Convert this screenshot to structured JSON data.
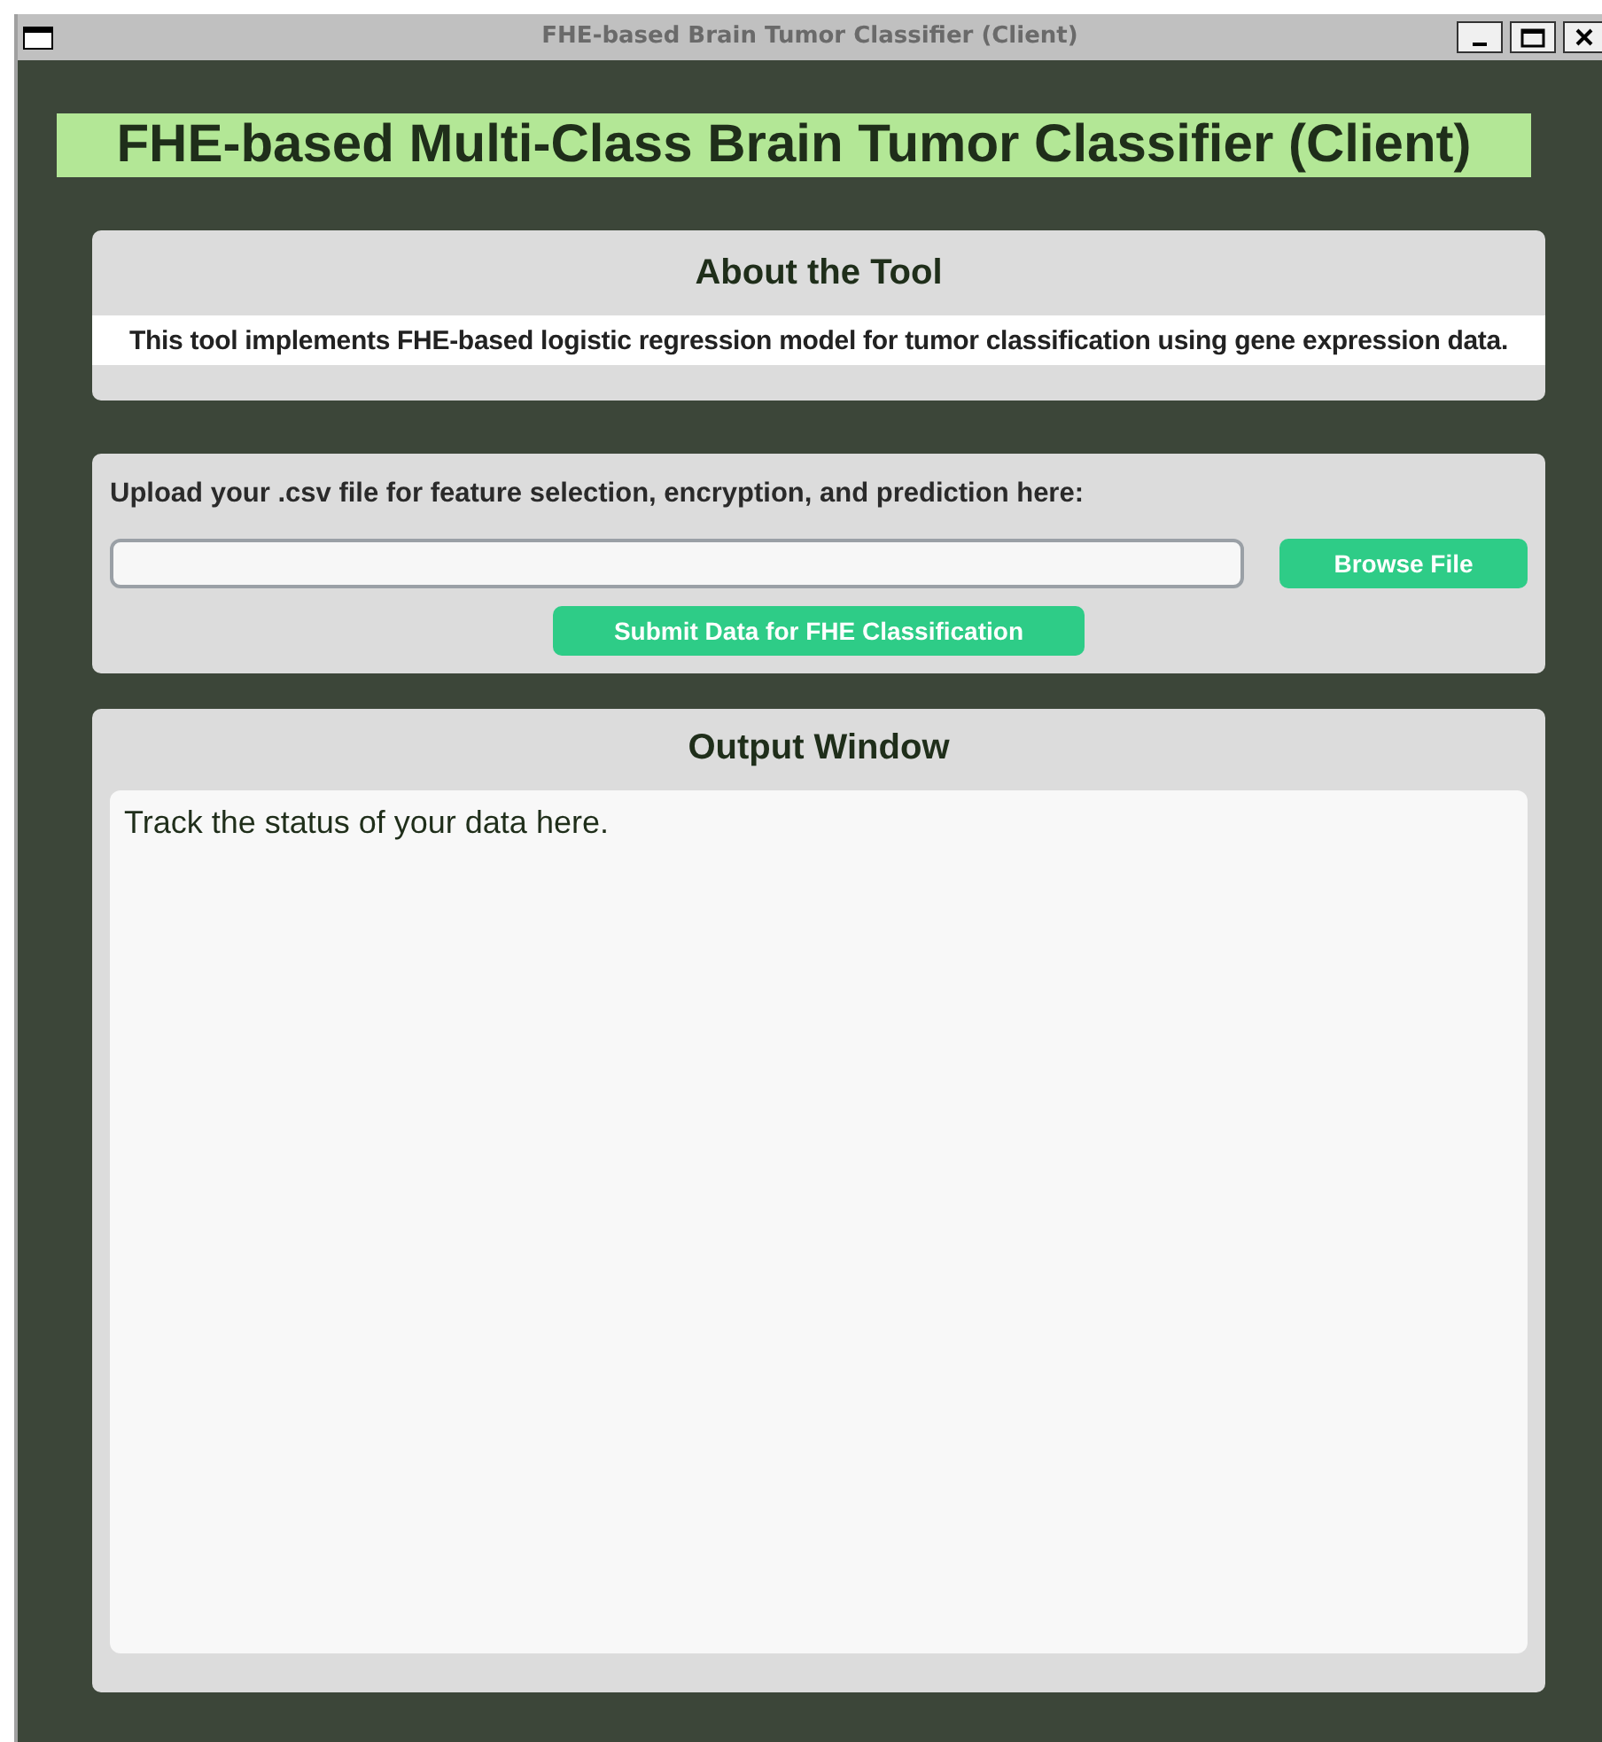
{
  "window": {
    "title": "FHE-based Brain Tumor Classifier (Client)"
  },
  "heading": "FHE-based Multi-Class Brain Tumor Classifier (Client)",
  "about": {
    "title": "About the Tool",
    "text": "This tool implements FHE-based logistic regression model for tumor classification using gene expression data."
  },
  "upload": {
    "label": "Upload your .csv file for feature selection, encryption, and prediction here:",
    "browse_button": "Browse File",
    "submit_button": "Submit Data for FHE Classification"
  },
  "output": {
    "title": "Output Window",
    "text": "Track the status of your data here."
  }
}
